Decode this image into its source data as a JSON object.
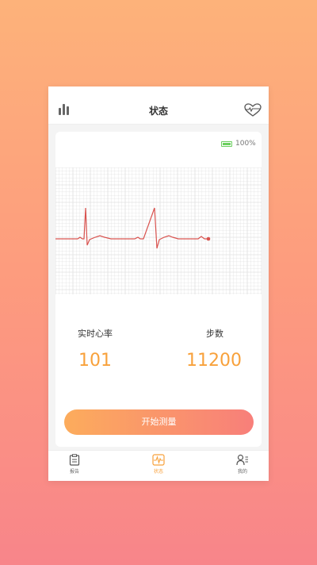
{
  "header": {
    "title": "状态",
    "left_icon": "bar-chart-icon",
    "right_icon": "heart-band-icon"
  },
  "battery": {
    "level_text": "100%",
    "level_fraction": 1.0,
    "color": "#6ccf5f"
  },
  "ecg": {
    "grid_color": "#e0e0e0",
    "trace_color": "#d9534f"
  },
  "stats": {
    "heart_rate": {
      "label": "实时心率",
      "value": "101"
    },
    "steps": {
      "label": "步数",
      "value": "11200"
    }
  },
  "action": {
    "start_label": "开始测量"
  },
  "tabs": [
    {
      "label": "报告",
      "icon": "clipboard-icon",
      "active": false
    },
    {
      "label": "状态",
      "icon": "pulse-icon",
      "active": true
    },
    {
      "label": "我的",
      "icon": "user-list-icon",
      "active": false
    }
  ],
  "colors": {
    "accent": "#f8a13b",
    "button_gradient_start": "#fcac5c",
    "button_gradient_end": "#f87f7a"
  }
}
